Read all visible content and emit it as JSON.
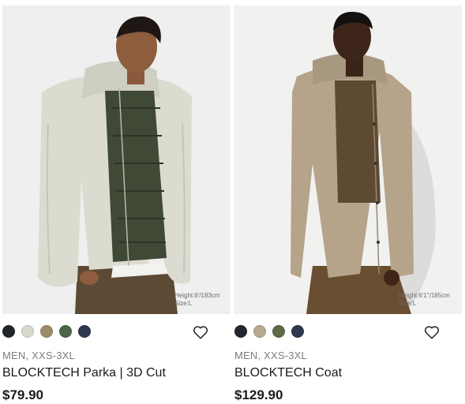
{
  "products": [
    {
      "model_height": "Height:6'/183cm",
      "model_size": "Size:L",
      "colors": [
        "#23272d",
        "#d9d8cc",
        "#9a8c66",
        "#4d6449",
        "#2e374d"
      ],
      "category": "MEN, XXS-3XL",
      "name": "BLOCKTECH Parka | 3D Cut",
      "price": "$79.90",
      "favorite_icon": "heart-outline-icon"
    },
    {
      "model_height": "Height:6'1\"/185cm",
      "model_size": "Size:L",
      "colors": [
        "#23272d",
        "#b7a890",
        "#5d6b47",
        "#2e374d"
      ],
      "category": "MEN, XXS-3XL",
      "name": "BLOCKTECH Coat",
      "price": "$129.90",
      "favorite_icon": "heart-outline-icon"
    }
  ]
}
